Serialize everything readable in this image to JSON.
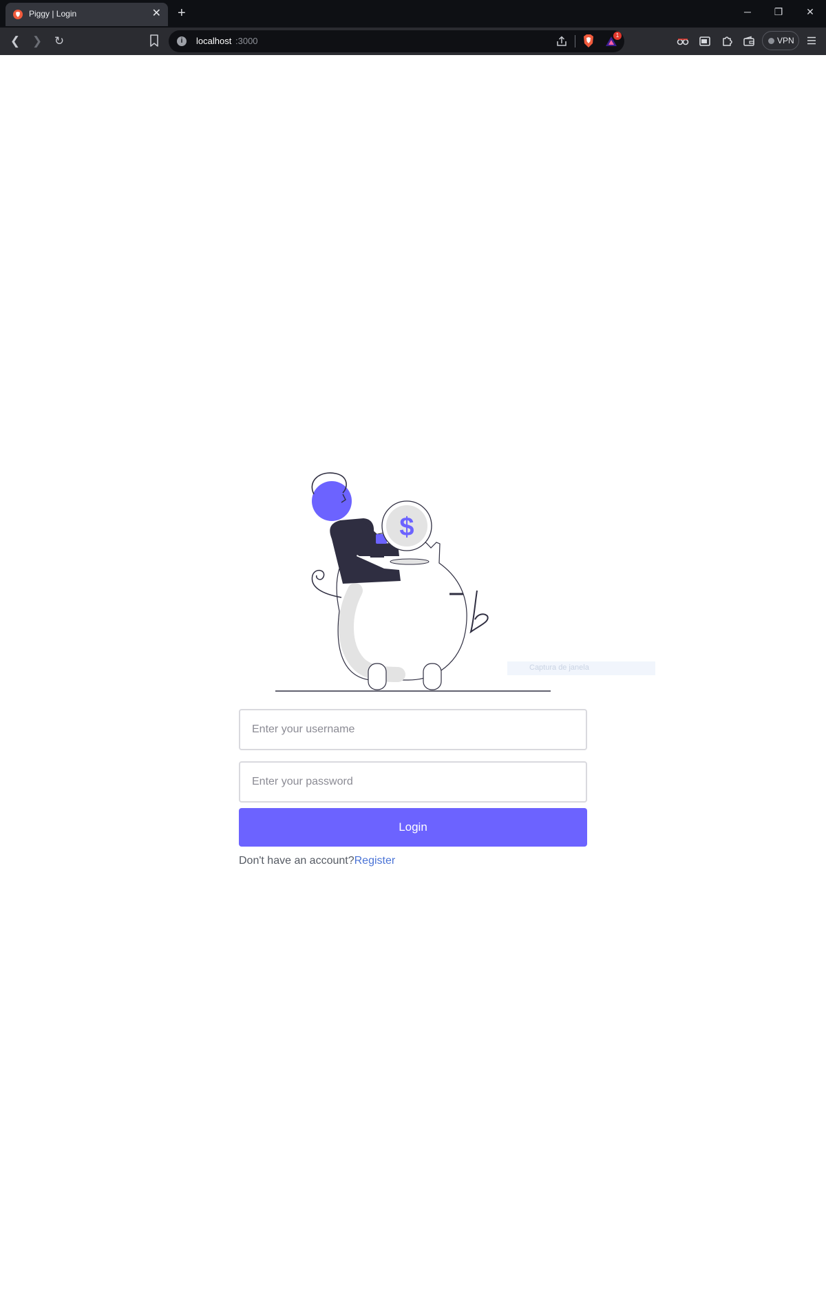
{
  "browser": {
    "tab": {
      "title": "Piggy | Login",
      "close_glyph": "✕",
      "favicon": "brave-logo-icon"
    },
    "new_tab_glyph": "+",
    "window_controls": {
      "minimize": "─",
      "restore": "❐",
      "close": "✕"
    },
    "nav": {
      "back": "❮",
      "forward": "❯",
      "reload": "↻"
    },
    "url": {
      "host": "localhost",
      "port": ":3000",
      "site_info_glyph": "i"
    },
    "rewards_badge": "1",
    "vpn_label": "VPN"
  },
  "ghost_overlay": {
    "text": "Captura de janela"
  },
  "form": {
    "username_placeholder": "Enter your username",
    "password_placeholder": "Enter your password",
    "login_label": "Login",
    "no_account_text": "Don't have an account?",
    "register_label": "Register"
  },
  "illustration": {
    "coin_symbol": "$"
  },
  "colors": {
    "accent": "#6c63ff",
    "link": "#4a73d6",
    "dark_figure": "#2f2e41",
    "tabbar_bg": "#0e1014",
    "toolbar_bg": "#2b2c31"
  }
}
